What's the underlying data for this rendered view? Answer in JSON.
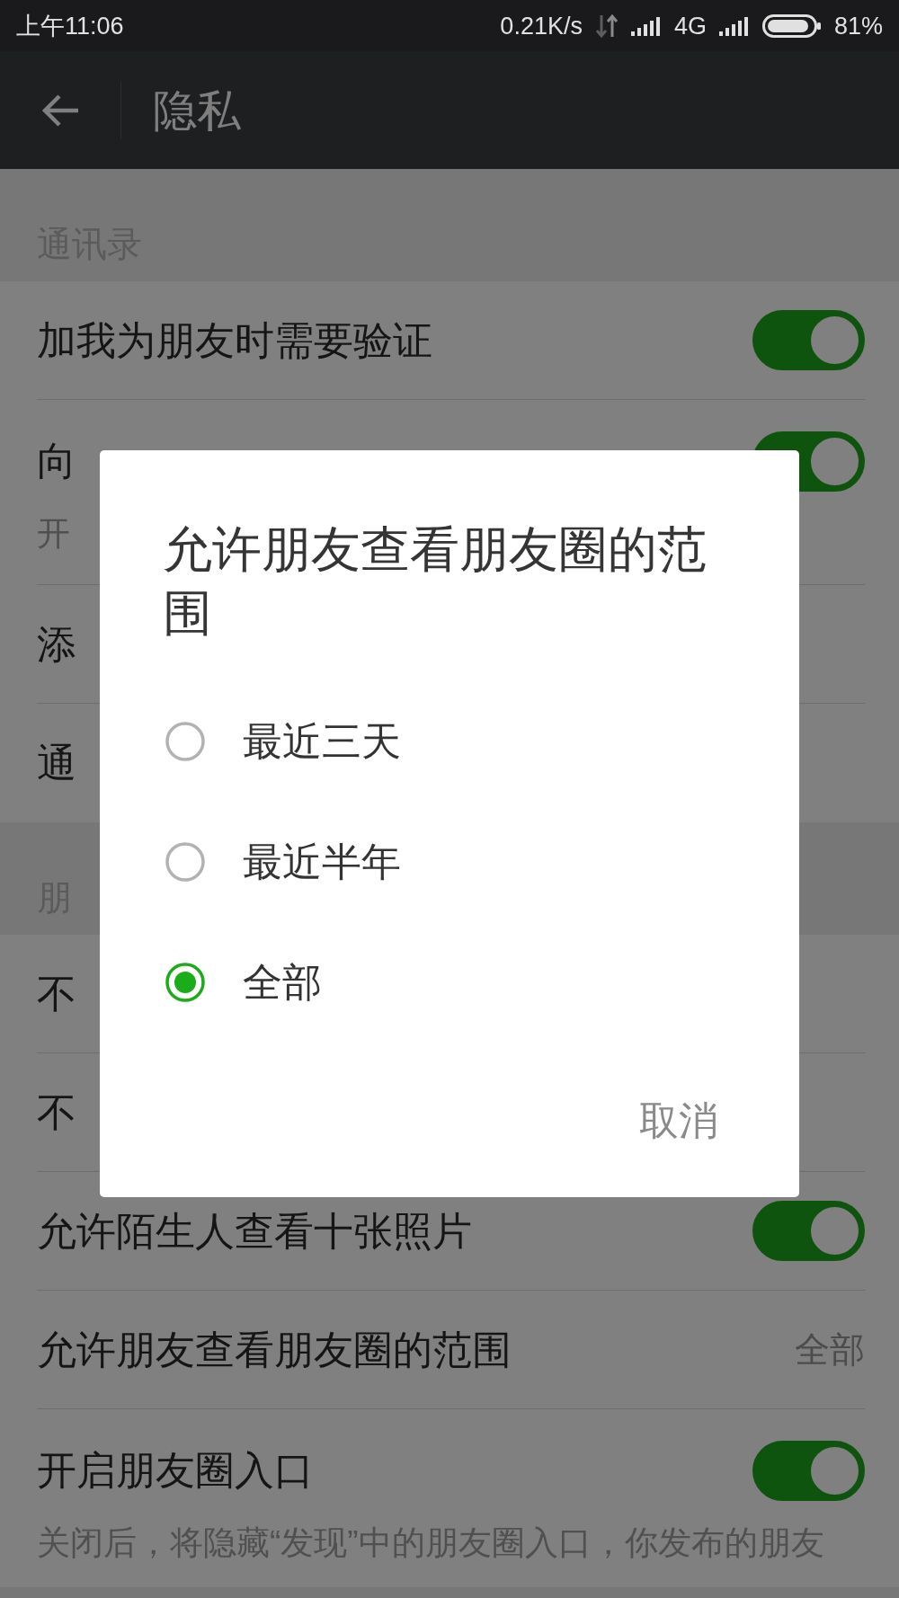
{
  "status_bar": {
    "time": "上午11:06",
    "speed": "0.21K/s",
    "network": "4G",
    "battery": "81%"
  },
  "app_bar": {
    "title": "隐私"
  },
  "sections": [
    {
      "header": "通讯录",
      "rows": [
        {
          "kind": "toggle",
          "title": "加我为朋友时需要验证",
          "on": true
        },
        {
          "kind": "toggle",
          "title": "向",
          "subtitle": "开",
          "on": true
        },
        {
          "kind": "link",
          "title": "添"
        },
        {
          "kind": "link",
          "title": "通"
        }
      ]
    },
    {
      "header": "朋",
      "rows": [
        {
          "kind": "link",
          "title": "不"
        },
        {
          "kind": "link",
          "title": "不"
        },
        {
          "kind": "toggle",
          "title": "允许陌生人查看十张照片",
          "on": true
        },
        {
          "kind": "value",
          "title": "允许朋友查看朋友圈的范围",
          "value": "全部"
        },
        {
          "kind": "toggle",
          "title": "开启朋友圈入口",
          "subtitle": "关闭后，将隐藏“发现”中的朋友圈入口，你发布的朋友",
          "on": true
        }
      ]
    }
  ],
  "dialog": {
    "title": "允许朋友查看朋友圈的范围",
    "options": [
      {
        "label": "最近三天",
        "selected": false
      },
      {
        "label": "最近半年",
        "selected": false
      },
      {
        "label": "全部",
        "selected": true
      }
    ],
    "buttons": [
      "取消"
    ]
  }
}
